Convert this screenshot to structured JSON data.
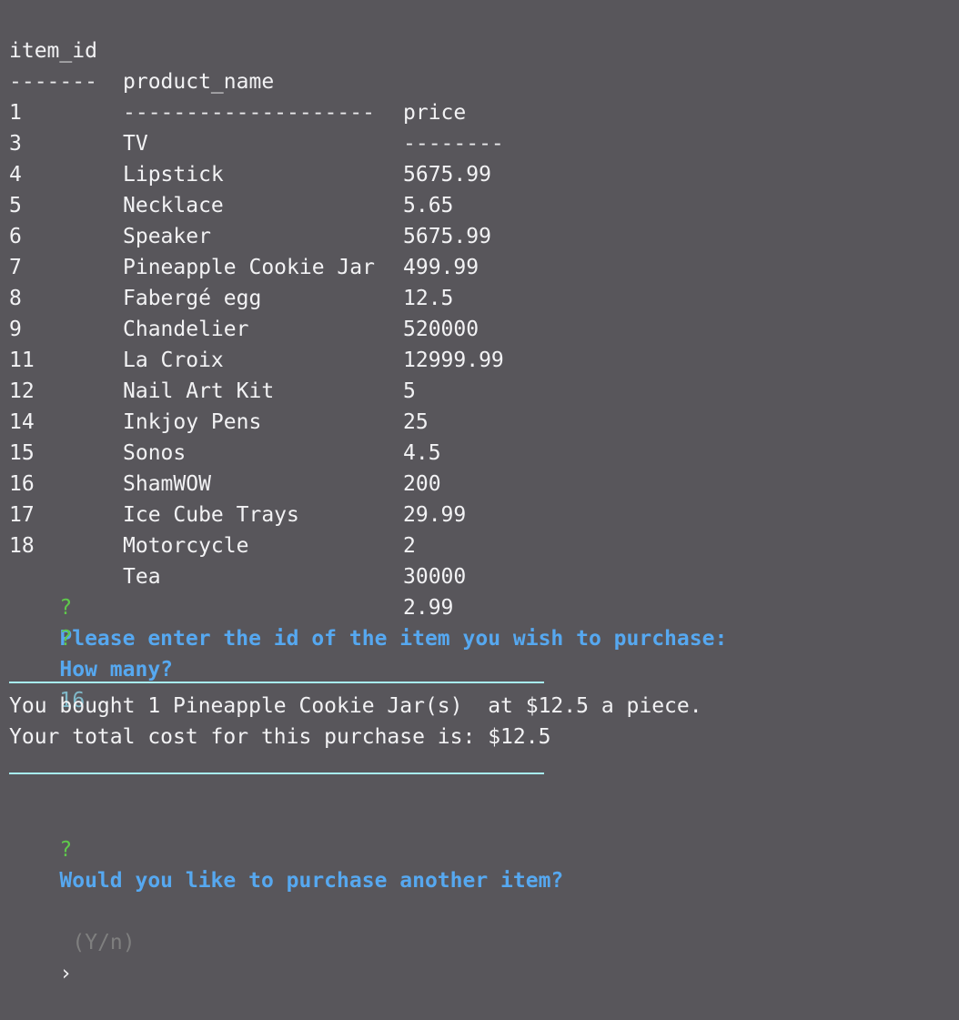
{
  "table": {
    "headers": {
      "id": "item_id",
      "name": "product_name",
      "price": "price"
    },
    "separators": {
      "id": "-------",
      "name": "--------------------",
      "price": "--------"
    },
    "rows": [
      {
        "id": "1",
        "name": "TV",
        "price": "5675.99"
      },
      {
        "id": "3",
        "name": "Lipstick",
        "price": "5.65"
      },
      {
        "id": "4",
        "name": "Necklace",
        "price": "5675.99"
      },
      {
        "id": "5",
        "name": "Speaker",
        "price": "499.99"
      },
      {
        "id": "6",
        "name": "Pineapple Cookie Jar",
        "price": "12.5"
      },
      {
        "id": "7",
        "name": "Fabergé egg",
        "price": "520000"
      },
      {
        "id": "8",
        "name": "Chandelier",
        "price": "12999.99"
      },
      {
        "id": "9",
        "name": "La Croix",
        "price": "5"
      },
      {
        "id": "11",
        "name": "Nail Art Kit",
        "price": "25"
      },
      {
        "id": "12",
        "name": "Inkjoy Pens",
        "price": "4.5"
      },
      {
        "id": "14",
        "name": "Sonos",
        "price": "200"
      },
      {
        "id": "15",
        "name": "ShamWOW",
        "price": "29.99"
      },
      {
        "id": "16",
        "name": "Ice Cube Trays",
        "price": "2"
      },
      {
        "id": "17",
        "name": "Motorcycle",
        "price": "30000"
      },
      {
        "id": "18",
        "name": "Tea",
        "price": "2.99"
      }
    ]
  },
  "prompts": {
    "mark": "?",
    "id_question": "Please enter the id of the item you wish to purchase:",
    "id_answer": "6",
    "qty_question": "How many?",
    "qty_answer": "1",
    "again_question": "Would you like to purchase another item?",
    "again_hint": "(Y/n)",
    "again_cursor": "›"
  },
  "receipt": {
    "line1": "You bought 1 Pineapple Cookie Jar(s)  at $12.5 a piece.",
    "line2": "Your total cost for this purchase is: $12.5"
  },
  "colors": {
    "background": "#58565b",
    "text": "#f2f2f4",
    "question_mark": "#5fc94b",
    "question_text": "#56a8f0",
    "answer": "#7fb8c8",
    "rule": "#a8eef4"
  }
}
